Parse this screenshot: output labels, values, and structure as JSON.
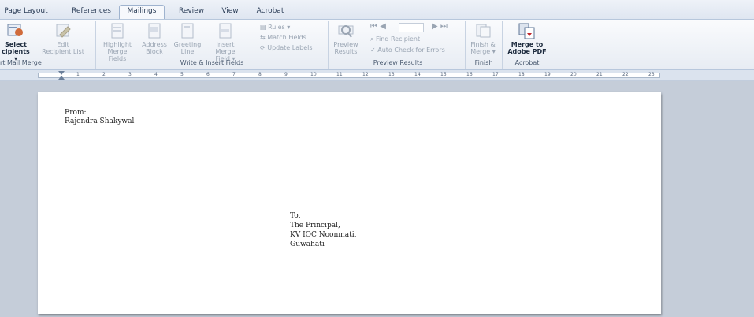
{
  "tabs": [
    "Page Layout",
    "References",
    "Mailings",
    "Review",
    "View",
    "Acrobat"
  ],
  "active_tab": "Mailings",
  "ribbon": {
    "start_mail_merge": {
      "group_label": "rt Mail Merge",
      "select_recipients": {
        "line1": "Select",
        "line2": "cipients ▾"
      },
      "edit_recipient_list": {
        "line1": "Edit",
        "line2": "Recipient List"
      }
    },
    "write_insert": {
      "group_label": "Write & Insert Fields",
      "highlight": {
        "line1": "Highlight",
        "line2": "Merge Fields"
      },
      "address": {
        "line1": "Address",
        "line2": "Block"
      },
      "greeting": {
        "line1": "Greeting",
        "line2": "Line"
      },
      "insert_merge": {
        "line1": "Insert Merge",
        "line2": "Field ▾"
      },
      "rules": "Rules ▾",
      "match_fields": "Match Fields",
      "update_labels": "Update Labels"
    },
    "preview": {
      "group_label": "Preview Results",
      "preview_results": {
        "line1": "Preview",
        "line2": "Results"
      },
      "find_recipient": "Find Recipient",
      "auto_check": "Auto Check for Errors",
      "nav": {
        "first": "⏮",
        "prev": "◀",
        "next": "▶",
        "last": "⏭"
      }
    },
    "finish": {
      "group_label": "Finish",
      "finish_merge": {
        "line1": "Finish &",
        "line2": "Merge ▾"
      }
    },
    "acrobat": {
      "group_label": "Acrobat",
      "merge_pdf": {
        "line1": "Merge to",
        "line2": "Adobe PDF"
      }
    }
  },
  "ruler": {
    "numbers": [
      "1",
      "2",
      "3",
      "4",
      "5",
      "6",
      "7",
      "8",
      "9",
      "10",
      "11",
      "12",
      "13",
      "14",
      "15",
      "16",
      "17",
      "18",
      "19",
      "20",
      "21",
      "22",
      "23"
    ]
  },
  "document": {
    "from_label": "From:",
    "from_name": "Rajendra  Shakywal",
    "to_lines": [
      "To,",
      "The Principal,",
      "KV IOC Noonmati,",
      "Guwahati"
    ]
  }
}
